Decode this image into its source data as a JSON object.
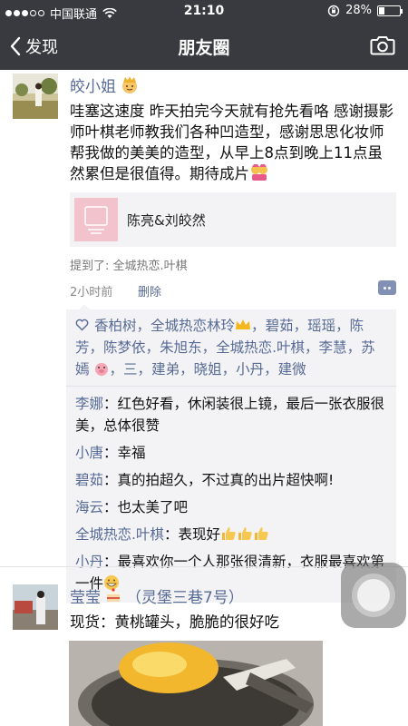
{
  "status": {
    "carrier": "中国联通",
    "time": "21:10",
    "battery": "28%",
    "battery_level": 0.28
  },
  "nav": {
    "back_label": "发现",
    "title": "朋友圈"
  },
  "post1": {
    "author": "皎小姐",
    "text": "哇塞这速度 昨天拍完今天就有抢先看咯 感谢摄影师叶棋老师教我们各种凹造型，感谢思思化妆师帮我做的美美的造型，从早上8点到晚上11点虽然累但是很值得。期待成片",
    "link_title": "陈亮&刘皎然",
    "mentioned": "提到了: 全城热恋.叶棋",
    "time": "2小时前",
    "delete_label": "删除",
    "likes": [
      "香柏树",
      "全城热恋林玲",
      "碧茹",
      "瑶瑶",
      "陈芳",
      "陈梦依",
      "朱旭东",
      "全城热恋.叶棋",
      "李慧",
      "苏嫣",
      "三",
      "建弟",
      "晓姐",
      "小丹",
      "建微"
    ],
    "comments": [
      {
        "name": "李娜",
        "text": "红色好看，休闲装很上镜，最后一张衣服很美，总体很赞"
      },
      {
        "name": "小唐",
        "text": "幸福"
      },
      {
        "name": "碧茹",
        "text": "真的拍超久，不过真的出片超快啊!"
      },
      {
        "name": "海云",
        "text": "也太美了吧"
      },
      {
        "name": "全城热恋.叶棋",
        "text": "表现好"
      },
      {
        "name": "小丹",
        "text": "最喜欢你一个人那张很清新，衣服最喜欢第一件"
      }
    ]
  },
  "post2": {
    "author": "莹莹",
    "author_suffix": "（灵堡三巷7号）",
    "text": "现货：黄桃罐头，脆脆的很好吃"
  },
  "colors": {
    "nav_bg": "#383a3f",
    "link_blue": "#576b95"
  }
}
